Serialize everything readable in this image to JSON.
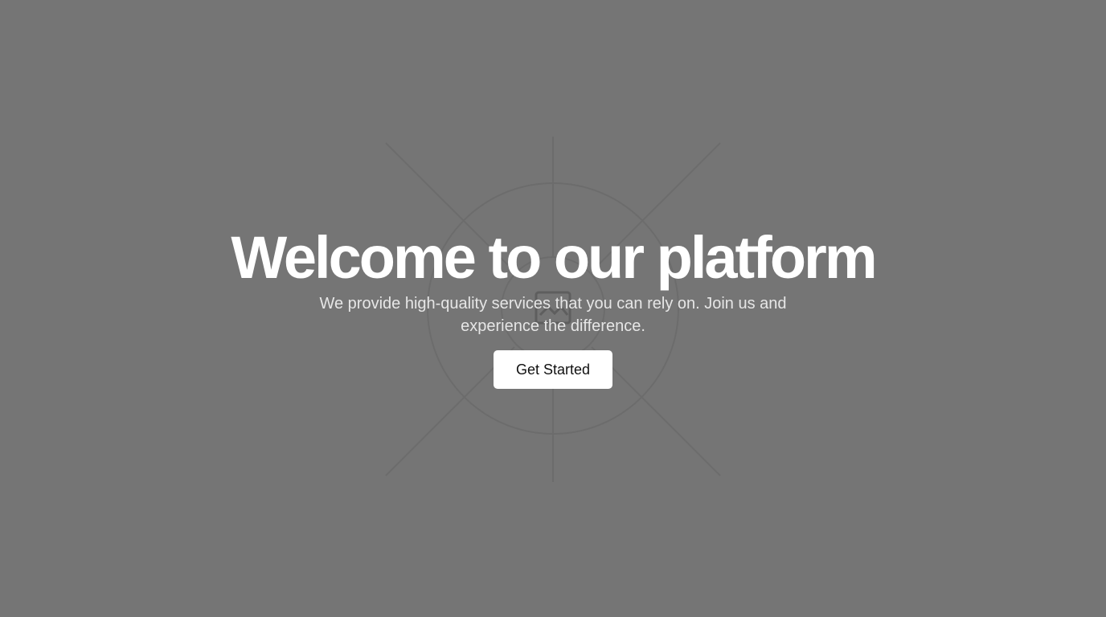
{
  "hero": {
    "title": "Welcome to our platform",
    "subtitle": "We provide high-quality services that you can rely on. Join us and experience the difference.",
    "cta_label": "Get Started"
  },
  "background": {
    "graphic_icon": "broken-image-icon"
  },
  "colors": {
    "page_background": "#757575",
    "title_text": "#ffffff",
    "subtitle_text": "#e6e6e6",
    "button_background": "#ffffff",
    "button_text": "#111111"
  }
}
